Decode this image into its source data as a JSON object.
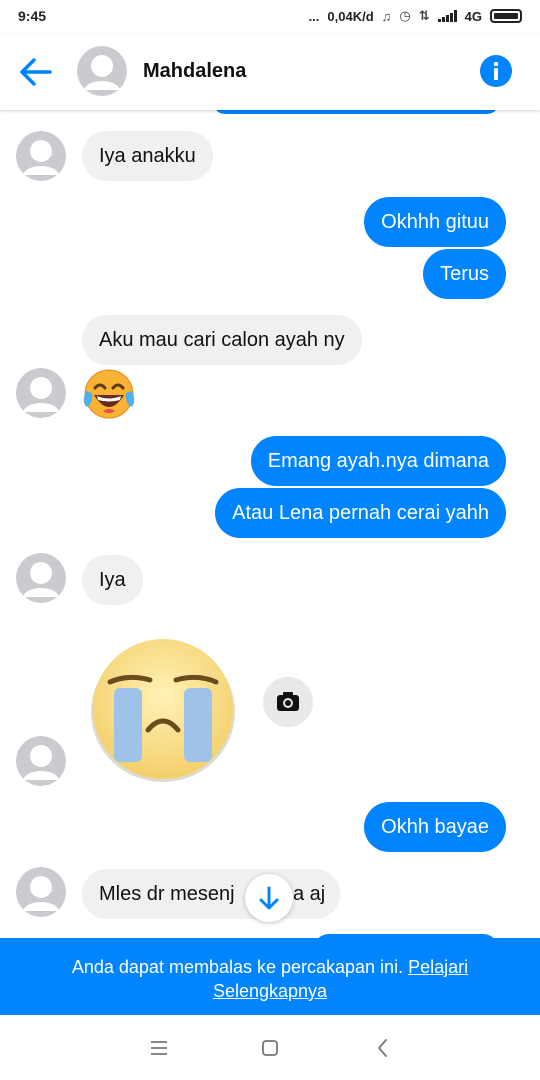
{
  "status_bar": {
    "time": "9:45",
    "speed": "0,04K/d",
    "network": "4G",
    "dots": "..."
  },
  "header": {
    "contact_name": "Mahdalena",
    "back_icon": "arrow-left-icon",
    "info_icon": "info-icon"
  },
  "messages": [
    {
      "side": "in",
      "text": "Iya anakku"
    },
    {
      "side": "out",
      "text": "Okhhh gituu"
    },
    {
      "side": "out",
      "text": "Terus"
    },
    {
      "side": "in",
      "text": "Aku mau cari calon ayah ny"
    },
    {
      "side": "in",
      "emoji": "face-with-tears-of-joy"
    },
    {
      "side": "out",
      "text": "Emang ayah.nya dimana"
    },
    {
      "side": "out",
      "text": "Atau Lena pernah cerai yahh"
    },
    {
      "side": "in",
      "text": "Iya"
    },
    {
      "side": "in",
      "sticker": "crying-face-sticker"
    },
    {
      "side": "out",
      "text": "Okhh bayae"
    },
    {
      "side": "in",
      "text_visible_start": "Mles dr mesenj",
      "text_visible_end": "a aj"
    }
  ],
  "notice": {
    "text": "Anda dapat membalas ke percakapan ini.",
    "link_part1": "Pelajari",
    "link_part2": "Selengkapnya"
  },
  "colors": {
    "accent": "#0084ff",
    "incoming_bubble": "#f1f0f0",
    "avatar_gray": "#c9cbcf"
  }
}
